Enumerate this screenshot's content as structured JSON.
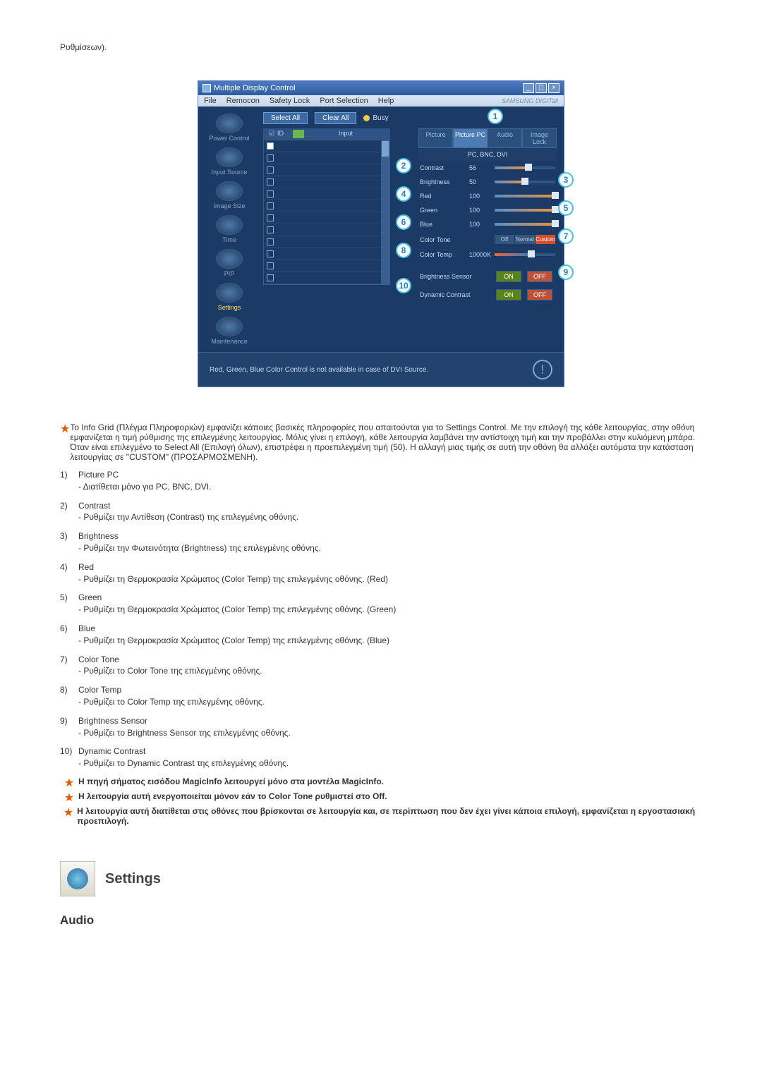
{
  "intro_tail": "Ρυθμίσεων).",
  "window": {
    "title": "Multiple Display Control",
    "menu": [
      "File",
      "Remocon",
      "Safety Lock",
      "Port Selection",
      "Help"
    ],
    "brand": "SAMSUNG DIGITall",
    "sidebar": [
      {
        "label": "Power Control"
      },
      {
        "label": "Input Source"
      },
      {
        "label": "Image Size"
      },
      {
        "label": "Time"
      },
      {
        "label": "PIP"
      },
      {
        "label": "Settings",
        "active": true
      },
      {
        "label": "Maintenance"
      }
    ],
    "select_all": "Select All",
    "clear_all": "Clear All",
    "busy": "Busy",
    "grid_headers": {
      "chk": "☑",
      "id": "ID",
      "dot": "",
      "input": "Input"
    },
    "tabs": [
      "Picture",
      "Picture PC",
      "Audio",
      "Image Lock"
    ],
    "active_tab": 1,
    "source_label": "PC, BNC, DVI",
    "sliders": [
      {
        "label": "Contrast",
        "value": "56",
        "pct": 56
      },
      {
        "label": "Brightness",
        "value": "50",
        "pct": 50
      },
      {
        "label": "Red",
        "value": "100",
        "pct": 100
      },
      {
        "label": "Green",
        "value": "100",
        "pct": 100
      },
      {
        "label": "Blue",
        "value": "100",
        "pct": 100
      }
    ],
    "color_tone": {
      "label": "Color Tone",
      "options": [
        "Off",
        "Normal",
        "Custom"
      ],
      "selected": 1
    },
    "color_temp": {
      "label": "Color Temp",
      "value": "10000K",
      "pct": 60
    },
    "brightness_sensor": {
      "label": "Brightness Sensor",
      "on": "ON",
      "off": "OFF"
    },
    "dynamic_contrast": {
      "label": "Dynamic Contrast",
      "on": "ON",
      "off": "OFF"
    },
    "hint": "Red, Green, Blue Color Control is not available in case of DVI Source."
  },
  "callouts": [
    "1",
    "2",
    "3",
    "4",
    "5",
    "6",
    "7",
    "8",
    "9",
    "10"
  ],
  "info_text": "Το Info Grid (Πλέγμα Πληροφοριών) εμφανίζει κάποιες βασικές πληροφορίες που απαιτούνται για το Settings Control. Με την επιλογή της κάθε λειτουργίας, στην οθόνη εμφανίζεται η τιμή ρύθμισης της επιλεγμένης λειτουργίας. Μόλις γίνει η επιλογή, κάθε λειτουργία λαμβάνει την αντίστοιχη τιμή και την προβάλλει στην κυλιόμενη μπάρα. Όταν είναι επιλεγμένο το Select All (Επιλογή όλων), επιστρέφει η προεπιλεγμένη τιμή (50). Η αλλαγή μιας τιμής σε αυτή την οθόνη θα αλλάξει αυτόματα την κατάσταση λειτουργίας σε \"CUSTOM\" (ΠΡΟΣΑΡΜΟΣΜΕΝΗ).",
  "items": [
    {
      "num": "1)",
      "title": "Picture PC",
      "desc": "- Διατίθεται μόνο για PC, BNC, DVI."
    },
    {
      "num": "2)",
      "title": "Contrast",
      "desc": "- Ρυθμίζει την Αντίθεση (Contrast) της επιλεγμένης οθόνης."
    },
    {
      "num": "3)",
      "title": "Brightness",
      "desc": "- Ρυθμίζει την Φωτεινότητα (Brightness) της επιλεγμένης οθόνης."
    },
    {
      "num": "4)",
      "title": "Red",
      "desc": "- Ρυθμίζει τη Θερμοκρασία Χρώματος (Color Temp) της επιλεγμένης οθόνης. (Red)"
    },
    {
      "num": "5)",
      "title": "Green",
      "desc": "- Ρυθμίζει τη Θερμοκρασία Χρώματος (Color Temp) της επιλεγμένης οθόνης. (Green)"
    },
    {
      "num": "6)",
      "title": "Blue",
      "desc": "- Ρυθμίζει τη Θερμοκρασία Χρώματος (Color Temp) της επιλεγμένης οθόνης. (Blue)"
    },
    {
      "num": "7)",
      "title": "Color Tone",
      "desc": "- Ρυθμίζει το Color Tone της επιλεγμένης οθόνης."
    },
    {
      "num": "8)",
      "title": "Color Temp",
      "desc": "- Ρυθμίζει το Color Temp της επιλεγμένης οθόνης."
    },
    {
      "num": "9)",
      "title": "Brightness Sensor",
      "desc": "- Ρυθμίζει το Brightness Sensor της επιλεγμένης οθόνης."
    },
    {
      "num": "10)",
      "title": "Dynamic Contrast",
      "desc": "- Ρυθμίζει το Dynamic Contrast της επιλεγμένης οθόνης."
    }
  ],
  "notes": [
    "Η πηγή σήματος εισόδου MagicInfo λειτουργεί μόνο στα μοντέλα MagicInfo.",
    "Η λειτουργία αυτή ενεργοποιείται μόνον εάν το Color Tone ρυθμιστεί στο Off.",
    "Η λειτουργία αυτή διατίθεται στις οθόνες που βρίσκονται σε λειτουργία και, σε περίπτωση που δεν έχει γίνει κάποια επιλογή, εμφανίζεται η εργοστασιακή προεπιλογή."
  ],
  "settings_heading": "Settings",
  "audio_heading": "Audio"
}
